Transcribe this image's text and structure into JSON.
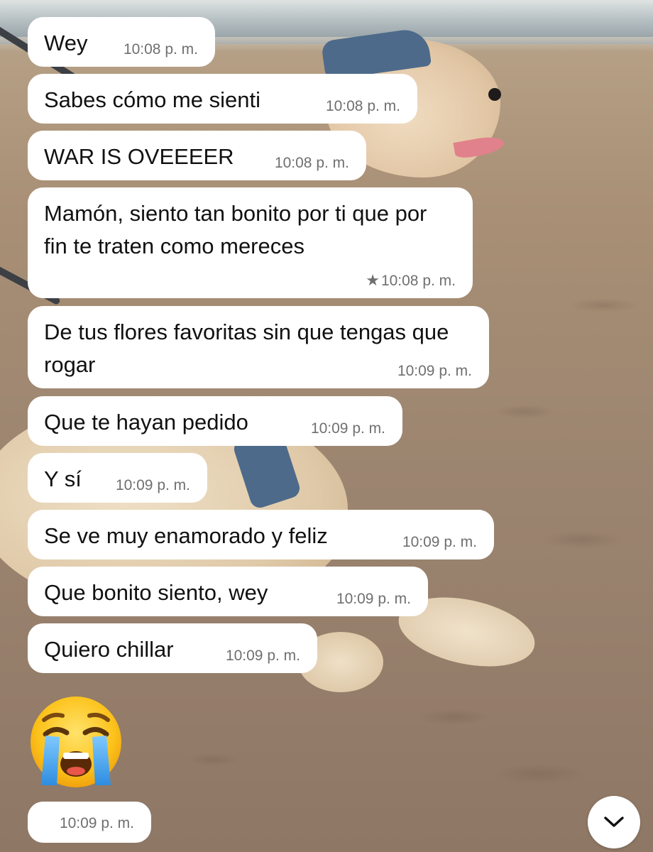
{
  "messages": [
    {
      "text": "Wey",
      "time": "10:08 p. m.",
      "starred": false
    },
    {
      "text": "Sabes cómo me sienti",
      "time": "10:08 p. m.",
      "starred": false
    },
    {
      "text": "WAR IS OVEEEER",
      "time": "10:08 p. m.",
      "starred": false
    },
    {
      "text": "Mamón, siento tan bonito por ti que por fin te traten como mereces",
      "time": "10:08 p. m.",
      "starred": true
    },
    {
      "text": "De tus flores favoritas sin que tengas que rogar",
      "time": "10:09 p. m.",
      "starred": false
    },
    {
      "text": "Que te hayan pedido",
      "time": "10:09 p. m.",
      "starred": false
    },
    {
      "text": "Y sí",
      "time": "10:09 p. m.",
      "starred": false
    },
    {
      "text": "Se ve muy enamorado y feliz",
      "time": "10:09 p. m.",
      "starred": false
    },
    {
      "text": "Que bonito siento, wey",
      "time": "10:09 p. m.",
      "starred": false
    },
    {
      "text": "Quiero chillar",
      "time": "10:09 p. m.",
      "starred": false
    }
  ],
  "emoji_message": {
    "emoji": "loudly-crying-face",
    "time": "10:09 p. m."
  },
  "star_glyph": "★",
  "scroll_button": {
    "icon": "chevron-down-icon"
  },
  "colors": {
    "bubble": "#ffffff",
    "timestamp": "#6f6f6f",
    "text": "#111111"
  }
}
